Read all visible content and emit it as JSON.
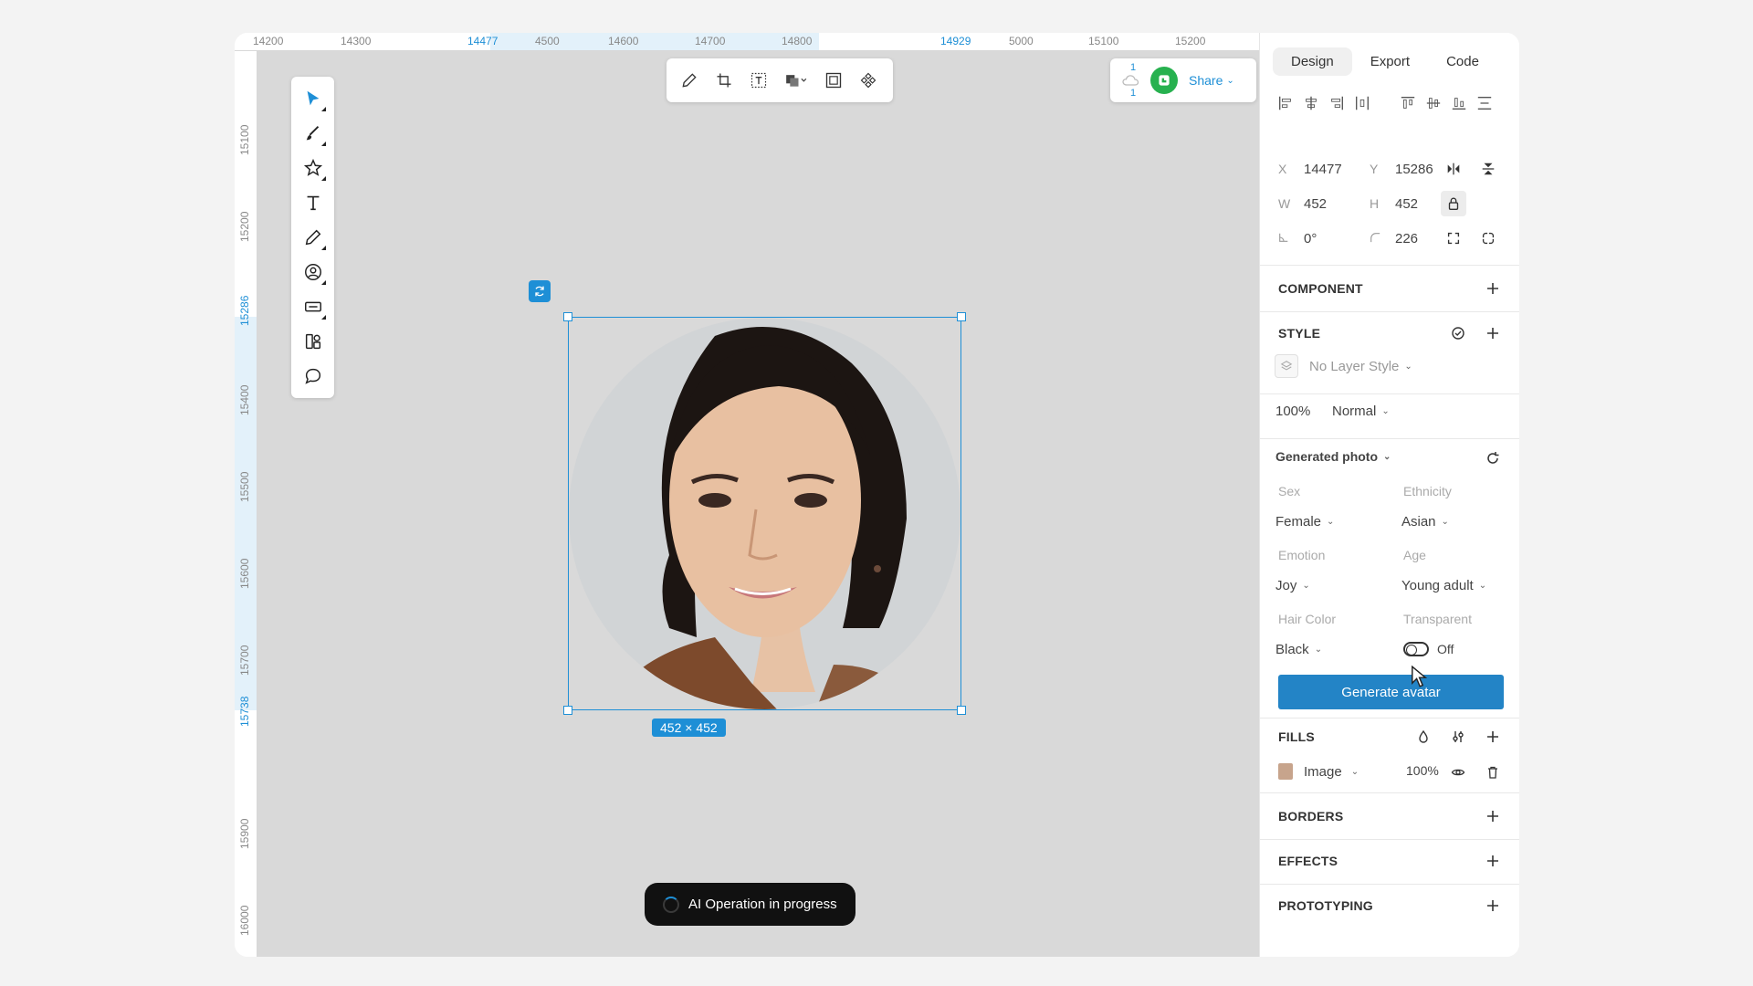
{
  "ruler": {
    "top_labels": [
      "14200",
      "14300",
      "14477",
      "4500",
      "14600",
      "14700",
      "14800",
      "14929",
      "5000",
      "15100",
      "15200"
    ],
    "top_selected": [
      "14477",
      "14929"
    ],
    "left_labels": [
      "15100",
      "15200",
      "15286",
      "15400",
      "15500",
      "15600",
      "15700",
      "15738",
      "15900",
      "16000"
    ],
    "left_selected": [
      "15286",
      "15738"
    ]
  },
  "toolbar": {
    "tools": [
      "select-icon",
      "brush-icon",
      "star-icon",
      "text-icon",
      "pencil-icon",
      "avatar-icon",
      "rectangle-icon",
      "components-icon",
      "comment-icon"
    ]
  },
  "context_bar": {
    "tools": [
      "edit-icon",
      "crop-icon",
      "text-frame-icon",
      "shapes-icon",
      "frame-icon",
      "component-icon"
    ]
  },
  "share": {
    "collab_top": "1",
    "collab_bottom": "1",
    "label": "Share"
  },
  "selection": {
    "size_label": "452 × 452"
  },
  "progress": {
    "label": "AI Operation in progress"
  },
  "panel": {
    "tabs": [
      "Design",
      "Export",
      "Code"
    ],
    "active_tab": "Design",
    "x_label": "X",
    "x_value": "14477",
    "y_label": "Y",
    "y_value": "15286",
    "w_label": "W",
    "w_value": "452",
    "h_label": "H",
    "h_value": "452",
    "rotation_value": "0°",
    "radius_value": "226",
    "component_title": "COMPONENT",
    "style_title": "STYLE",
    "layer_style": "No Layer Style",
    "opacity": "100%",
    "blend": "Normal",
    "generated_title": "Generated photo",
    "sex_label": "Sex",
    "sex_value": "Female",
    "ethnicity_label": "Ethnicity",
    "ethnicity_value": "Asian",
    "emotion_label": "Emotion",
    "emotion_value": "Joy",
    "age_label": "Age",
    "age_value": "Young adult",
    "hair_label": "Hair Color",
    "hair_value": "Black",
    "transparent_label": "Transparent",
    "transparent_value": "Off",
    "generate_button": "Generate avatar",
    "fills_title": "FILLS",
    "fill_type": "Image",
    "fill_opacity": "100%",
    "borders_title": "BORDERS",
    "effects_title": "EFFECTS",
    "prototyping_title": "PROTOTYPING"
  },
  "colors": {
    "accent": "#1e8fd6",
    "button": "#2384c6",
    "canvas": "#d9d9d9",
    "collaborator": "#27b14f"
  }
}
